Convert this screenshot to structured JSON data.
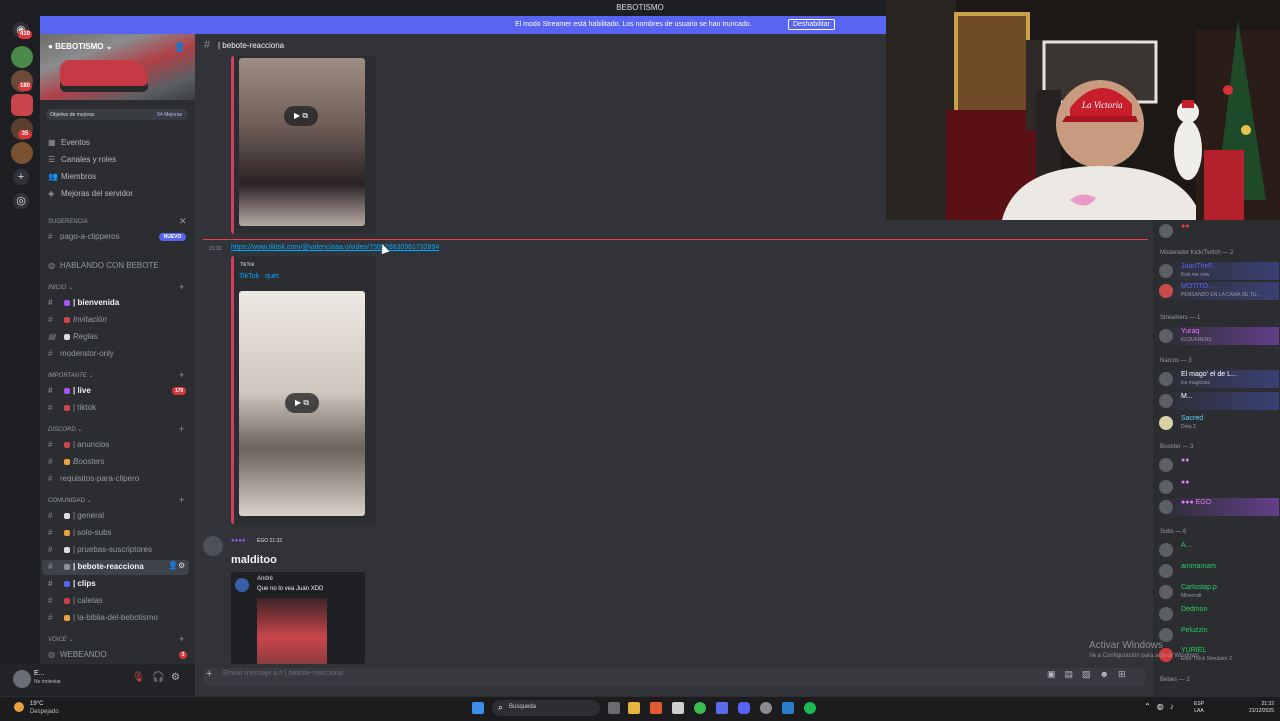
{
  "window": {
    "title": "BEBOTISMO"
  },
  "banner": {
    "message": "El modo Streamer está habilitado. Los nombres de usuario se han truncado.",
    "button": "Deshabilitar"
  },
  "rail": {
    "badges": [
      "410",
      "180",
      "35"
    ]
  },
  "server": {
    "name": "BEBOTISMO",
    "boost_goal": "Objetivo de mejoras",
    "boost_count": "54 Mejoras",
    "nav": [
      {
        "icon": "calendar-icon",
        "label": "Eventos"
      },
      {
        "icon": "channels-icon",
        "label": "Canales y roles"
      },
      {
        "icon": "members-icon",
        "label": "Miembros"
      },
      {
        "icon": "boost-icon",
        "label": "Mejoras del servidor"
      }
    ],
    "suggestion": {
      "title": "Sugerencia",
      "channel": "pago-a-clipperos",
      "badge": "NUEVO"
    },
    "hablando": "HABLANDO CON BEBOTE",
    "categories": {
      "inicio": "INICIO",
      "importante": "IMPORTANTE",
      "discord": "DISCORD",
      "comunidad": "COMUNIDAD",
      "voice": "VOICE"
    },
    "channels": {
      "bienvenida": "| bienvenida",
      "invitacion": "Invitación",
      "reglas": "Reglas",
      "moderator": "moderator-only",
      "live": "| live",
      "live_badge": "179",
      "tiktok": "| tiktok",
      "anuncios": "| anuncios",
      "boosters": "Boosters",
      "requisitos": "requisitos-para-clipero",
      "general": "| general",
      "solo_subs": "| solo-subs",
      "pruebas": "| pruebas-suscriptores",
      "bebote": "| bebote-reacciona",
      "clips": "| clips",
      "caletas": "| caletas",
      "biblia": "| la-biblia-del-bebotismo",
      "webeando": "WEBEANDO",
      "webeando_badge": "3"
    }
  },
  "user": {
    "name": "E...",
    "status": "No molestar"
  },
  "chat": {
    "channel_title": "| bebote-reacciona",
    "link_time": "21:32",
    "link": "https://www.tiktok.com/@valenciaaa.o/video/758526630961732894",
    "embed_source": "TikTok",
    "embed_title": "TikTok · quet",
    "author_badges": "EGO 21:32",
    "message": "malditoo",
    "quote_name": "André",
    "quote_text": "Que no lo vea Juan XDD",
    "input_placeholder": "Enviar mensaje a #    | bebote-reacciona"
  },
  "members": {
    "groups": {
      "mod": "Moderador Kick/Twitch — 2",
      "streamers": "Streamers — 1",
      "narcos": "Narcos — 3",
      "booster": "Booster — 3",
      "subs": "Subs — 6",
      "bebes": "Bebes — 2"
    },
    "mod_members": [
      {
        "name": "JuanTheF...",
        "sub": "Kick me now",
        "color": "#5865f2"
      },
      {
        "name": "MOTITO...",
        "sub": "PENSANDO EN LA CAMA DE TU...",
        "color": "#5865f2"
      }
    ],
    "streamer": {
      "name": "Yuraq",
      "sub": "KLOUFRENS",
      "color": "#e879f9"
    },
    "narcos_members": [
      {
        "name": "El mago' el de L...",
        "sub": "los magicoss",
        "color": "#ffffff"
      },
      {
        "name": "M...",
        "sub": "",
        "color": "#ffffff"
      },
      {
        "name": "Sacred",
        "sub": "Dota 2",
        "color": "#5bd6ff"
      }
    ],
    "subs_members": [
      {
        "name": "A...",
        "sub": "",
        "color": "#23d160"
      },
      {
        "name": "ammamam",
        "sub": "",
        "color": "#23d160"
      },
      {
        "name": "Carlostap.p",
        "sub": "Minecraft",
        "color": "#23d160"
      },
      {
        "name": "Dedmon",
        "sub": "",
        "color": "#23d160"
      },
      {
        "name": "Peluzzin",
        "sub": "",
        "color": "#23d160"
      },
      {
        "name": "YURIEL",
        "sub": "Euro Truck Simulator 2",
        "color": "#23d160"
      }
    ]
  },
  "watermark": {
    "line1": "Activar Windows",
    "line2": "Ve a Configuración para activar Windows."
  },
  "taskbar": {
    "temp": "19°C",
    "weather": "Despejado",
    "search": "Búsqueda",
    "lang1": "ESP",
    "lang2": "LAA",
    "time": "21:32",
    "date": "21/12/2025"
  }
}
